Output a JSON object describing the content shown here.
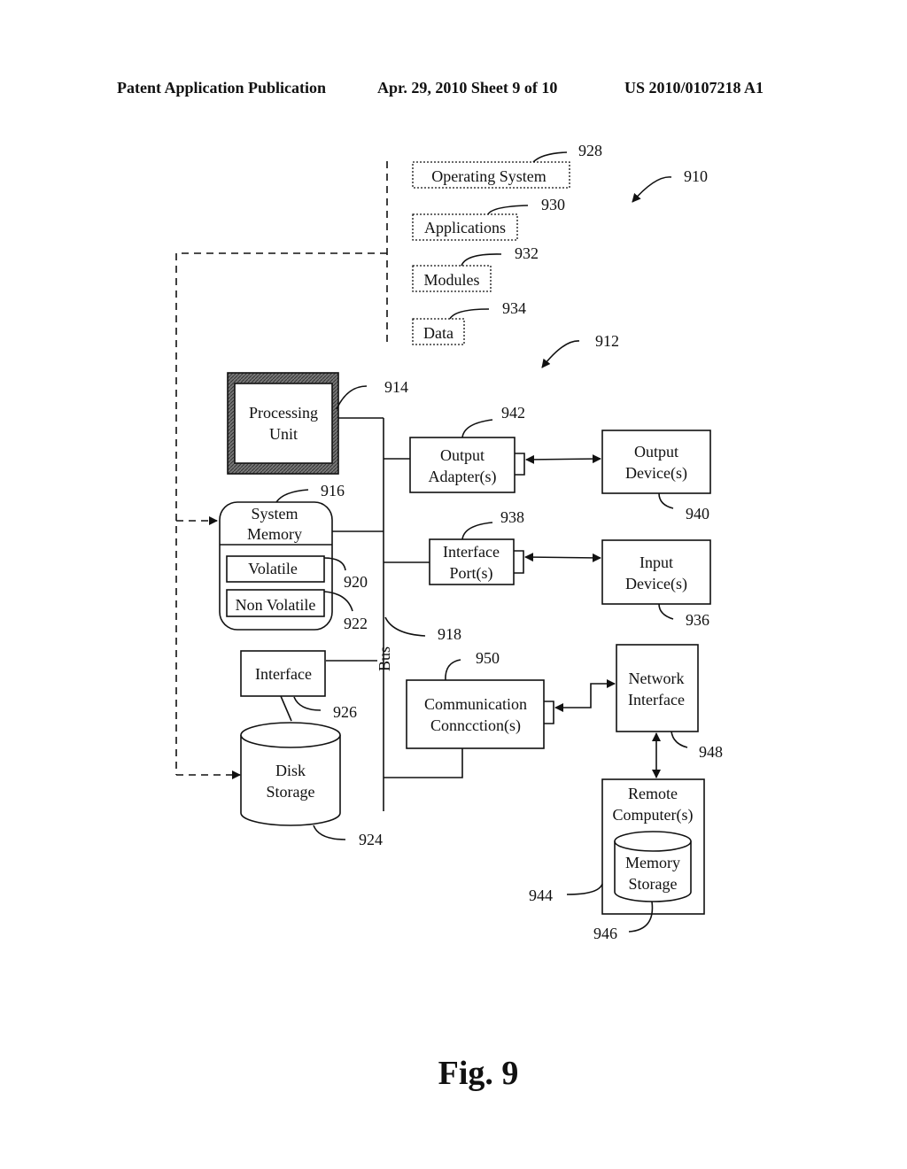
{
  "header": {
    "publication": "Patent Application Publication",
    "date_sheet": "Apr. 29, 2010  Sheet 9 of 10",
    "number": "US 2010/0107218 A1"
  },
  "figure": {
    "caption": "Fig. 9",
    "software": {
      "operating_system": {
        "label": "Operating System",
        "ref": "928"
      },
      "applications": {
        "label": "Applications",
        "ref": "930"
      },
      "modules": {
        "label": "Modules",
        "ref": "932"
      },
      "data": {
        "label": "Data",
        "ref": "934"
      },
      "group_ref": "910"
    },
    "computer_ref": "912",
    "processing_unit": {
      "line1": "Processing",
      "line2": "Unit",
      "ref": "914"
    },
    "system_memory": {
      "line1": "System",
      "line2": "Memory",
      "ref": "916",
      "volatile": {
        "label": "Volatile",
        "ref": "920"
      },
      "non_volatile": {
        "label": "Non Volatile",
        "ref": "922"
      }
    },
    "bus": {
      "label": "Bus",
      "ref": "918"
    },
    "interface": {
      "label": "Interface",
      "ref": "926"
    },
    "disk_storage": {
      "line1": "Disk",
      "line2": "Storage",
      "ref": "924"
    },
    "output_adapter": {
      "line1": "Output",
      "line2": "Adapter(s)",
      "ref": "942"
    },
    "output_device": {
      "line1": "Output",
      "line2": "Device(s)",
      "ref": "940"
    },
    "interface_port": {
      "line1": "Interface",
      "line2": "Port(s)",
      "ref": "938"
    },
    "input_device": {
      "line1": "Input",
      "line2": "Device(s)",
      "ref": "936"
    },
    "communication_connection": {
      "line1": "Communication",
      "line2": "Conncction(s)",
      "ref": "950"
    },
    "network_interface": {
      "line1": "Network",
      "line2": "Interface",
      "ref": "948"
    },
    "remote_computer": {
      "line1": "Remote",
      "line2": "Computer(s)",
      "ref": "944"
    },
    "memory_storage": {
      "line1": "Memory",
      "line2": "Storage",
      "ref": "946"
    }
  }
}
